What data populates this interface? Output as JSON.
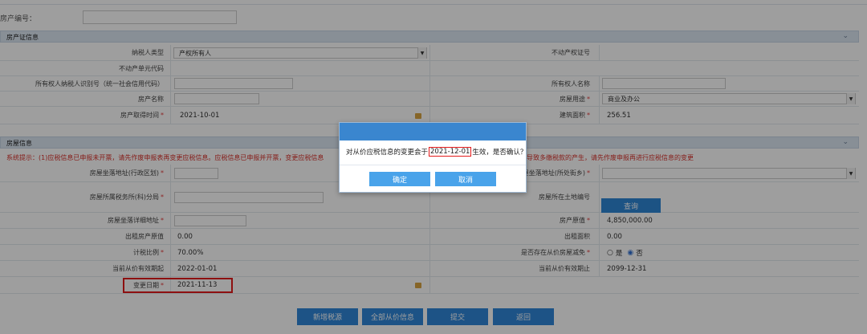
{
  "top": {
    "label": "房产编号："
  },
  "section1": {
    "title": "房产证信息",
    "taxpayer_type_label": "纳税人类型",
    "taxpayer_type_value": "产权所有人",
    "cert_no_label": "不动产权证号",
    "unit_code_label": "不动产单元代码",
    "owner_id_label": "所有权人纳税人识别号（统一社会信用代码）",
    "owner_name_label": "所有权人名称",
    "property_name_label": "房产名称",
    "usage_label": "房屋用途",
    "usage_value": "商业及办公",
    "acquire_time_label": "房产取得时间",
    "acquire_time_value": "2021-10-01",
    "area_label": "建筑面积",
    "area_value": "256.51"
  },
  "section2": {
    "title": "房屋信息",
    "notice_left": "系统提示：(1)应税信息已申报未开票，请先作废申报表再变更应税信息。应税信息已申报并开票，变更应税信息",
    "notice_right": "导致多缴税款的产生，请先作废申报再进行应税信息的变更",
    "addr_district_label": "房屋坐落地址(行政区划)",
    "addr_street_label": "屋坐落地址(所处街乡)",
    "tax_office_label": "房屋所属税务所(科)分局",
    "land_no_label": "房屋所在土地编号",
    "query_button": "查询",
    "addr_detail_label": "房屋坐落详细地址",
    "original_value_label": "房产原值",
    "original_value": "4,850,000.00",
    "rent_original_label": "出租房产原值",
    "rent_original_value": "0.00",
    "rent_area_label": "出租面积",
    "rent_area_value": "0.00",
    "tax_ratio_label": "计税比例",
    "tax_ratio_value": "70.00%",
    "reduction_label": "是否存在从价房屋减免",
    "yes_label": "是",
    "no_label": "否",
    "valid_start_label": "当前从价有效期起",
    "valid_start_value": "2022-01-01",
    "valid_end_label": "当前从价有效期止",
    "valid_end_value": "2099-12-31",
    "change_date_label": "变更日期",
    "change_date_value": "2021-11-13"
  },
  "bottom_buttons": [
    "新增税源",
    "全部从价信息",
    "提交",
    "返回"
  ],
  "dialog": {
    "message_before": "对从价应税信息的变更会于",
    "message_date": "2021-12-01",
    "message_after": "生效，是否确认？",
    "confirm": "确定",
    "cancel": "取消"
  },
  "colors": {
    "panel_header": "#dce7f3",
    "accent_blue": "#2f87d8",
    "dialog_header": "#3a86cf",
    "dialog_button": "#49a3ea",
    "required_red": "#e23b3b",
    "highlight_red": "#e41a1a"
  },
  "icons": {
    "calendar": "calendar-icon",
    "chevron": "chevron-down-icon",
    "select_arrow": "dropdown-arrow-icon"
  }
}
